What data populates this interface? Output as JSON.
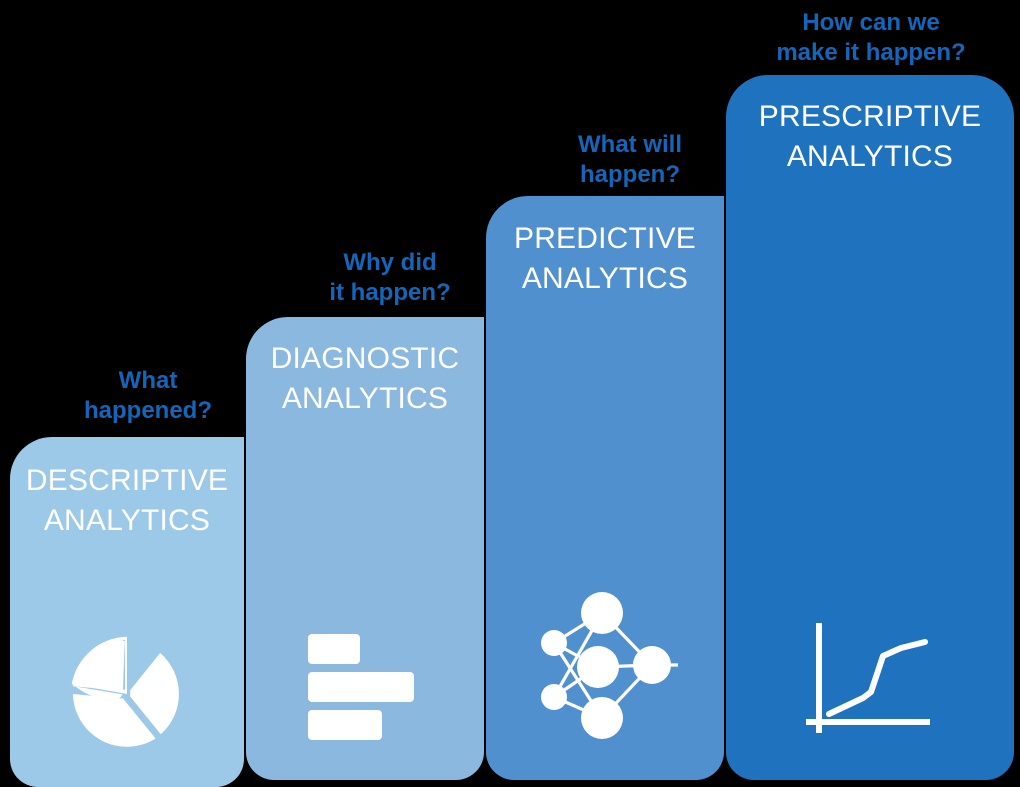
{
  "background_color": "#000000",
  "theme": {
    "question_text_color": "#1565b8",
    "stage_text_color": "#ffffff",
    "icon_color": "#ffffff"
  },
  "diagram": {
    "type": "analytics-maturity-staircase",
    "stages": [
      {
        "id": "descriptive",
        "question": "What\nhappened?",
        "title": "DESCRIPTIVE\nANALYTICS",
        "icon": "pie-chart-icon",
        "color": "#9cc9e8",
        "height_rank": 1
      },
      {
        "id": "diagnostic",
        "question": "Why did\nit happen?",
        "title": "DIAGNOSTIC\nANALYTICS",
        "icon": "bar-chart-icon",
        "color": "#8bb8de",
        "height_rank": 2
      },
      {
        "id": "predictive",
        "question": "What will\nhappen?",
        "title": "PREDICTIVE\nANALYTICS",
        "icon": "neural-network-icon",
        "color": "#5190ce",
        "height_rank": 3
      },
      {
        "id": "prescriptive",
        "question": "How can we\nmake it happen?",
        "title": "PRESCRIPTIVE\nANALYTICS",
        "icon": "line-chart-icon",
        "color": "#1f73be",
        "height_rank": 4
      }
    ]
  }
}
